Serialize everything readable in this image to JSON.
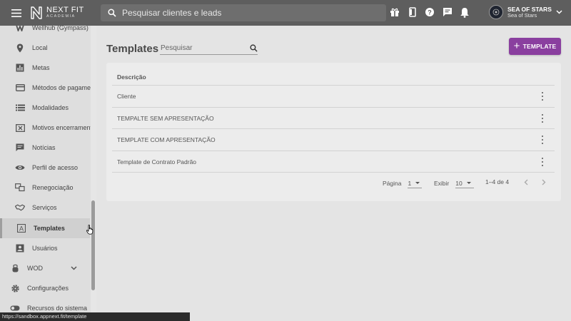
{
  "brand": {
    "name": "NEXT FIT",
    "sub": "ACADEMIA"
  },
  "search": {
    "placeholder": "Pesquisar clientes e leads"
  },
  "user": {
    "name": "SEA OF STARS",
    "org": "Sea of Stars"
  },
  "top_icons": [
    "gift-icon",
    "phone-icon",
    "help-icon",
    "chat-icon",
    "bell-icon"
  ],
  "sidebar": {
    "items": [
      {
        "label": "Wellhub (Gympass)",
        "icon": "wellhub-icon"
      },
      {
        "label": "Local",
        "icon": "location-icon"
      },
      {
        "label": "Metas",
        "icon": "chart-icon"
      },
      {
        "label": "Métodos de pagamen",
        "icon": "card-icon"
      },
      {
        "label": "Modalidades",
        "icon": "list-icon"
      },
      {
        "label": "Motivos encerrament",
        "icon": "x-box-icon"
      },
      {
        "label": "Notícias",
        "icon": "news-icon"
      },
      {
        "label": "Perfil de acesso",
        "icon": "eye-icon"
      },
      {
        "label": "Renegociação",
        "icon": "renegotiation-icon"
      },
      {
        "label": "Serviços",
        "icon": "handshake-icon"
      },
      {
        "label": "Templates",
        "icon": "template-icon"
      },
      {
        "label": "Usuários",
        "icon": "user-box-icon"
      },
      {
        "label": "WOD",
        "icon": "kettlebell-icon"
      },
      {
        "label": "Configurações",
        "icon": "gear-icon"
      },
      {
        "label": "Recursos do sistema",
        "icon": "toggle-icon"
      }
    ]
  },
  "main": {
    "title": "Templates",
    "search_placeholder": "Pesquisar",
    "new_button": "TEMPLATE",
    "column": "Descrição",
    "rows": [
      "Cliente",
      "TEMPALTE SEM APRESENTAÇÃO",
      "TEMPLATE COM APRESENTAÇÃO",
      "Template de Contrato Padrão"
    ],
    "pager": {
      "page_label": "Página",
      "page_value": "1",
      "per_page_label": "Exibir",
      "per_page_value": "10",
      "range": "1–4 de 4"
    }
  },
  "status_url": "https://sandbox.appnext.fit/template",
  "colors": {
    "topbar": "#5e5e5e",
    "accent": "#8a3f9f",
    "background": "#e4e4e4"
  }
}
